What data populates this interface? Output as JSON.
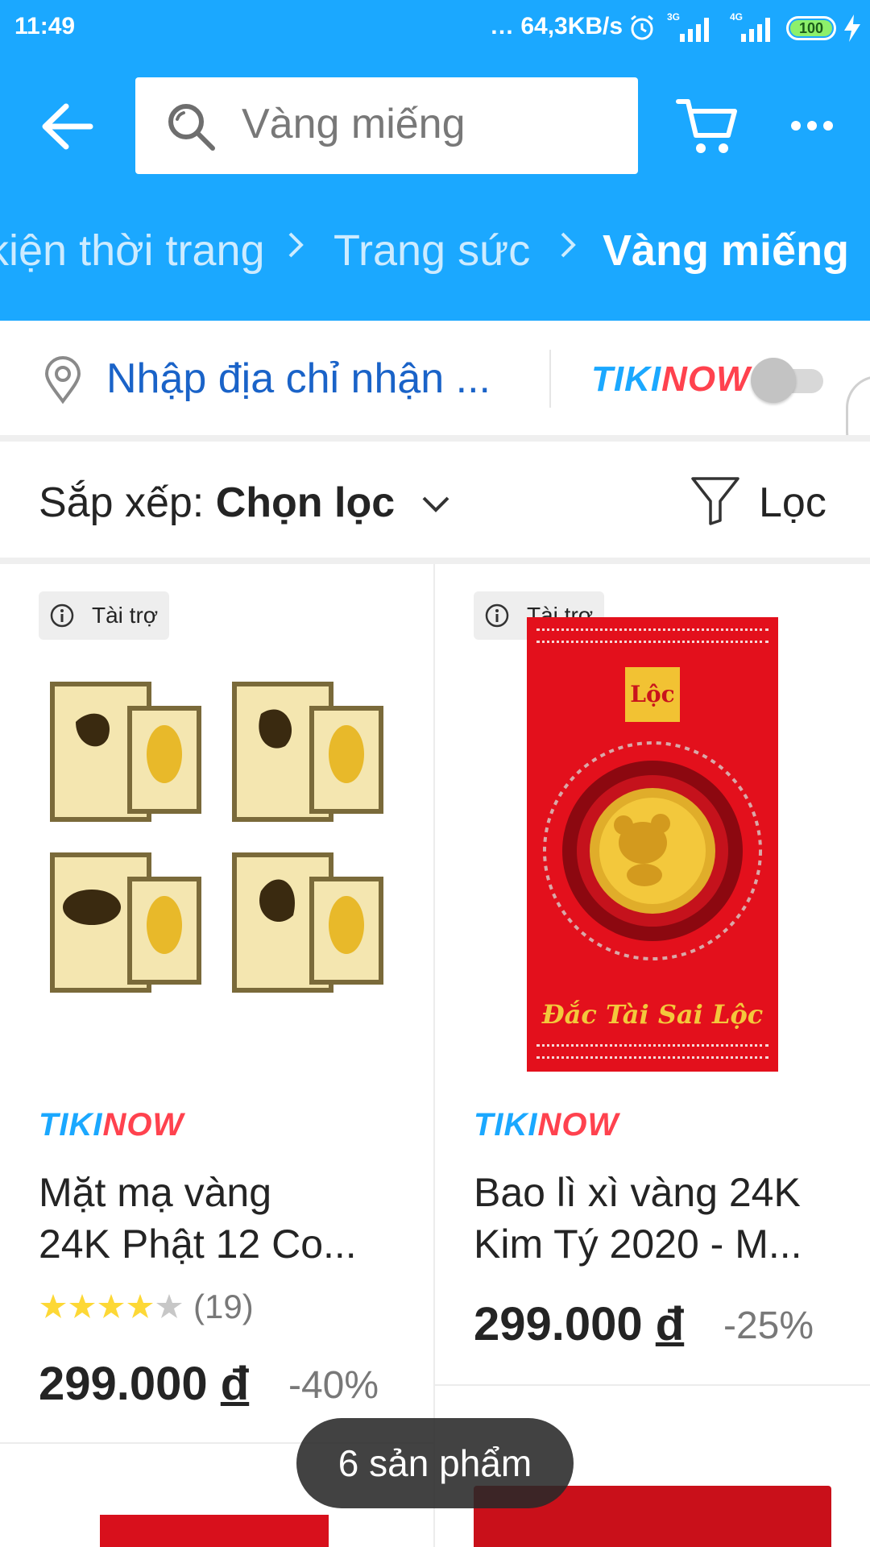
{
  "status_bar": {
    "time": "11:49",
    "network_speed": "… 64,3KB/s",
    "signal1_label": "3G",
    "signal2_label": "4G",
    "battery": "100"
  },
  "header": {
    "search_placeholder": "Vàng miếng",
    "accent_color": "#1ba8ff"
  },
  "breadcrumb": [
    "kiện thời trang",
    "Trang sức",
    "Vàng miếng"
  ],
  "address_bar": {
    "address_prompt": "Nhập địa chỉ nhận ...",
    "tikinow_logo": {
      "part1": "TIKI",
      "part2": "NOW"
    },
    "tikinow_toggle_on": false
  },
  "sort_bar": {
    "sort_prefix": "Sắp xếp:",
    "sort_value": "Chọn lọc",
    "filter_label": "Lọc"
  },
  "products": [
    {
      "badge": "Tài trợ",
      "seller_logo": {
        "part1": "TIKI",
        "part2": "NOW"
      },
      "name_line1": "Mặt mạ vàng",
      "name_line2": "24K Phật 12 Co...",
      "rating": 4,
      "review_count": "(19)",
      "price": "299.000",
      "currency": "đ",
      "discount": "-40%"
    },
    {
      "badge": "Tài trợ",
      "seller_logo": {
        "part1": "TIKI",
        "part2": "NOW"
      },
      "name_line1": "Bao lì xì vàng 24K",
      "name_line2": "Kim Tý 2020 - M...",
      "price": "299.000",
      "currency": "đ",
      "discount": "-25%",
      "image_text_top": "Lộc",
      "image_text_bottom": "Đắc Tài Sai Lộc"
    }
  ],
  "toast": "6 sản phẩm"
}
